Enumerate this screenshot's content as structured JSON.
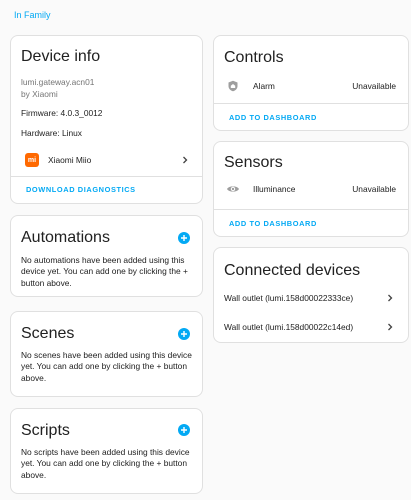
{
  "breadcrumb": {
    "area": "In Family"
  },
  "device_info": {
    "title": "Device info",
    "model": "lumi.gateway.acn01",
    "manufacturer": "by Xiaomi",
    "firmware": "Firmware: 4.0.3_0012",
    "hardware": "Hardware: Linux",
    "integration": {
      "label": "Xiaomi Miio",
      "icon": "xiaomi-logo-icon",
      "logo_text": "mi",
      "color": "#ff6900"
    },
    "action": "Download diagnostics"
  },
  "automations": {
    "title": "Automations",
    "text": "No automations have been added using this device yet. You can add one by clicking the + button above."
  },
  "scenes": {
    "title": "Scenes",
    "text": "No scenes have been added using this device yet. You can add one by clicking the + button above."
  },
  "scripts": {
    "title": "Scripts",
    "text": "No scripts have been added using this device yet. You can add one by clicking the + button above."
  },
  "controls": {
    "title": "Controls",
    "entity": {
      "name": "Alarm",
      "state": "Unavailable",
      "icon": "shield-home-icon"
    },
    "action": "Add to dashboard"
  },
  "sensors": {
    "title": "Sensors",
    "entity": {
      "name": "Illuminance",
      "state": "Unavailable",
      "icon": "eye-icon"
    },
    "action": "Add to dashboard"
  },
  "connected": {
    "title": "Connected devices",
    "items": [
      {
        "label": "Wall outlet (lumi.158d00022333ce)"
      },
      {
        "label": "Wall outlet (lumi.158d00022c14ed)"
      }
    ]
  },
  "colors": {
    "accent": "#03a9f4",
    "text": "#212121",
    "muted": "#757575",
    "border": "#e0e0e0"
  }
}
